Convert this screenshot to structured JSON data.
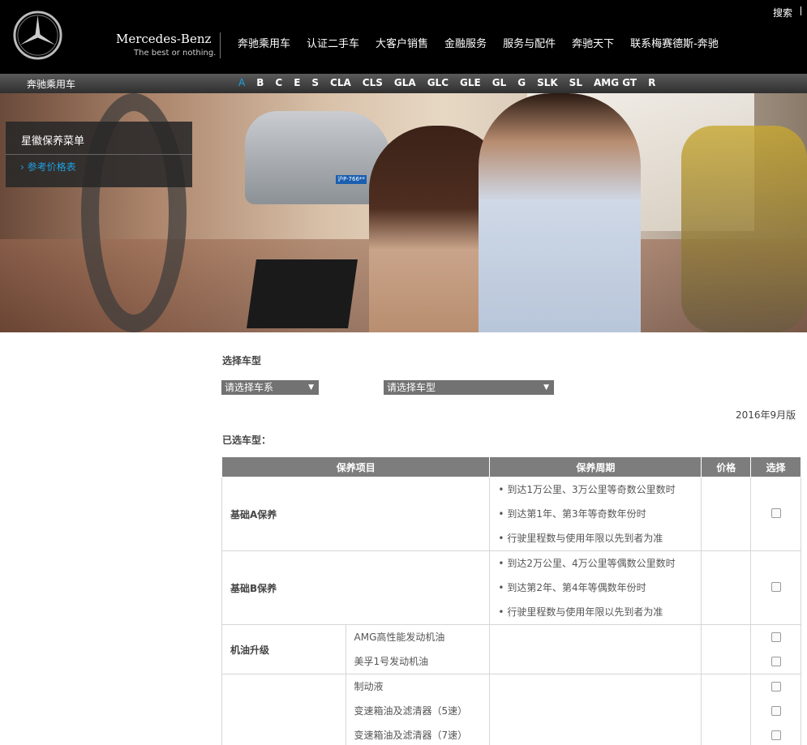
{
  "header": {
    "brand": "Mercedes-Benz",
    "tagline": "The best or nothing.",
    "search": "搜索",
    "nav": [
      "奔驰乘用车",
      "认证二手车",
      "大客户销售",
      "金融服务",
      "服务与配件",
      "奔驰天下",
      "联系梅赛德斯-奔驰"
    ]
  },
  "model_bar": {
    "title": "奔驰乘用车",
    "models": [
      "A",
      "B",
      "C",
      "E",
      "S",
      "CLA",
      "CLS",
      "GLA",
      "GLC",
      "GLE",
      "GL",
      "G",
      "SLK",
      "SL",
      "AMG GT",
      "R"
    ],
    "active": "A"
  },
  "hero": {
    "plate": "沪P·766** "
  },
  "side_menu": {
    "title": "星徽保养菜单",
    "item": "参考价格表"
  },
  "content": {
    "select_heading": "选择车型",
    "series_select": "请选择车系",
    "model_select": "请选择车型",
    "edition": "2016年9月版",
    "selected_label": "已选车型："
  },
  "table": {
    "headers": [
      "保养项目",
      "保养周期",
      "价格",
      "选择"
    ],
    "row_a": {
      "name": "基础A保养",
      "periods": [
        "• 到达1万公里、3万公里等奇数公里数时",
        "• 到达第1年、第3年等奇数年份时",
        "• 行驶里程数与使用年限以先到者为准"
      ]
    },
    "row_b": {
      "name": "基础B保养",
      "periods": [
        "• 到达2万公里、4万公里等偶数公里数时",
        "• 到达第2年、第4年等偶数年份时",
        "• 行驶里程数与使用年限以先到者为准"
      ]
    },
    "row_oil": {
      "name": "机油升级",
      "items": [
        "AMG高性能发动机油",
        "美孚1号发动机油"
      ]
    },
    "row_fluids": {
      "items": [
        "制动液",
        "变速箱油及滤清器（5速）",
        "变速箱油及滤清器（7速）"
      ]
    }
  }
}
